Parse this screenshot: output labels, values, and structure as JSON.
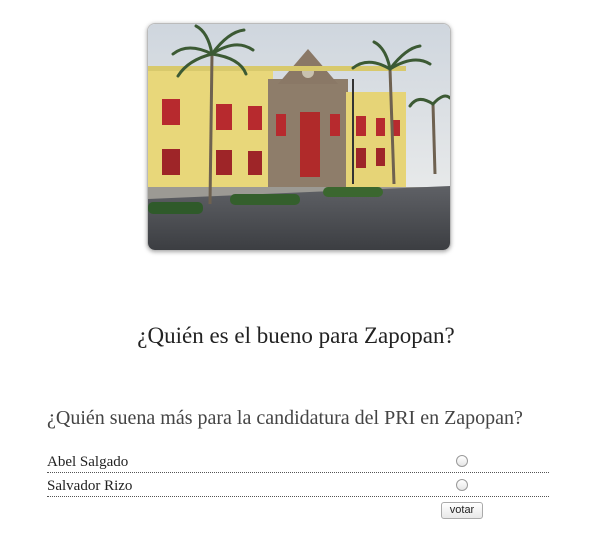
{
  "photo": {
    "subject": "palacio-municipal-zapopan"
  },
  "headline": "¿Quién es el bueno para Zapopan?",
  "poll": {
    "question": "¿Quién suena más para la candidatura del PRI en Zapopan?",
    "options": [
      {
        "label": "Abel Salgado",
        "selected": false
      },
      {
        "label": "Salvador Rizo",
        "selected": false
      }
    ],
    "vote_label": "votar"
  }
}
